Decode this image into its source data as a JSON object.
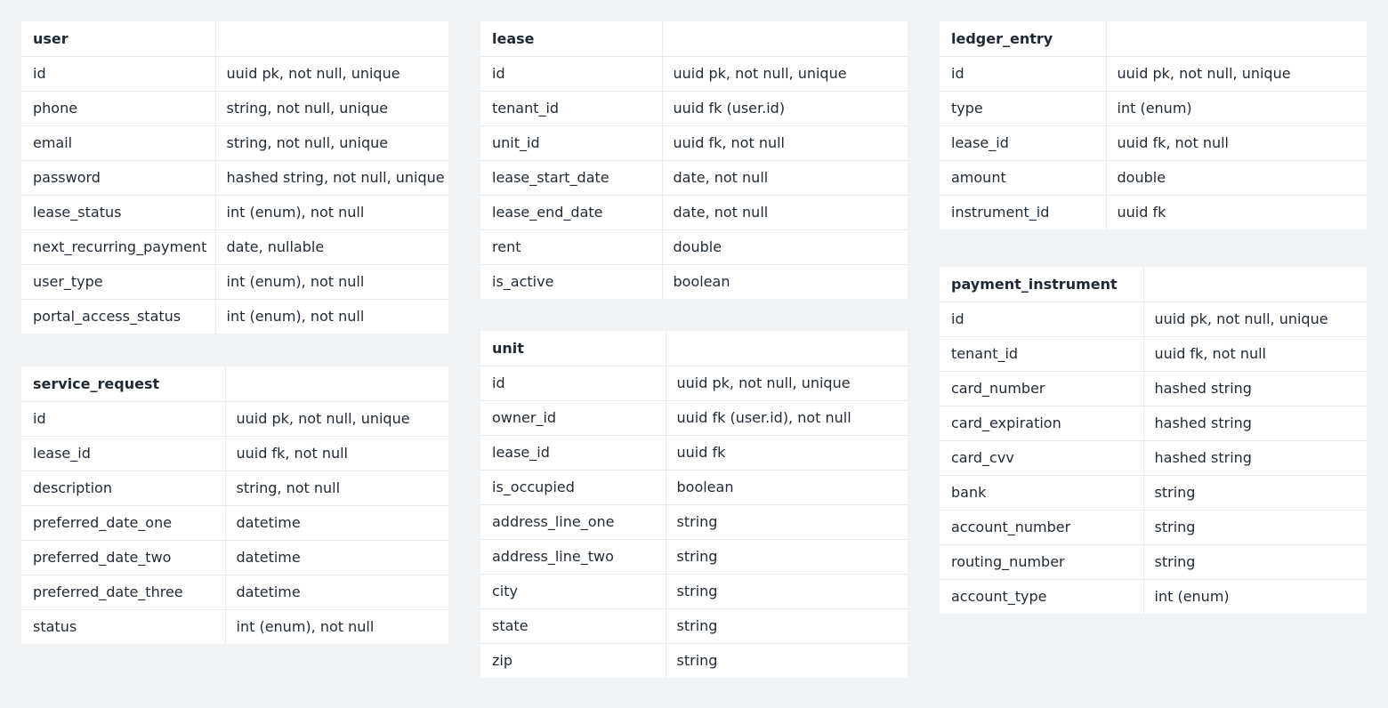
{
  "tables": {
    "user": {
      "title": "user",
      "rows": [
        {
          "field": "id",
          "spec": "uuid pk, not null, unique"
        },
        {
          "field": "phone",
          "spec": "string, not null, unique"
        },
        {
          "field": "email",
          "spec": "string, not null, unique"
        },
        {
          "field": "password",
          "spec": "hashed string, not null, unique"
        },
        {
          "field": "lease_status",
          "spec": "int (enum), not null"
        },
        {
          "field": "next_recurring_payment",
          "spec": "date, nullable"
        },
        {
          "field": "user_type",
          "spec": "int (enum), not null"
        },
        {
          "field": "portal_access_status",
          "spec": "int (enum),  not null"
        }
      ]
    },
    "service_request": {
      "title": "service_request",
      "rows": [
        {
          "field": "id",
          "spec": "uuid pk, not null, unique"
        },
        {
          "field": "lease_id",
          "spec": "uuid fk, not null"
        },
        {
          "field": "description",
          "spec": "string, not null"
        },
        {
          "field": "preferred_date_one",
          "spec": "datetime"
        },
        {
          "field": "preferred_date_two",
          "spec": "datetime"
        },
        {
          "field": "preferred_date_three",
          "spec": "datetime"
        },
        {
          "field": "status",
          "spec": "int (enum), not null"
        }
      ]
    },
    "lease": {
      "title": "lease",
      "rows": [
        {
          "field": "id",
          "spec": "uuid pk, not null, unique"
        },
        {
          "field": "tenant_id",
          "spec": "uuid fk (user.id)"
        },
        {
          "field": "unit_id",
          "spec": "uuid fk, not null"
        },
        {
          "field": "lease_start_date",
          "spec": "date, not null"
        },
        {
          "field": "lease_end_date",
          "spec": "date, not null"
        },
        {
          "field": "rent",
          "spec": "double"
        },
        {
          "field": "is_active",
          "spec": "boolean"
        }
      ]
    },
    "unit": {
      "title": "unit",
      "rows": [
        {
          "field": "id",
          "spec": "uuid pk, not null, unique"
        },
        {
          "field": "owner_id",
          "spec": "uuid fk (user.id), not null"
        },
        {
          "field": "lease_id",
          "spec": "uuid fk"
        },
        {
          "field": "is_occupied",
          "spec": "boolean"
        },
        {
          "field": "address_line_one",
          "spec": "string"
        },
        {
          "field": "address_line_two",
          "spec": "string"
        },
        {
          "field": "city",
          "spec": "string"
        },
        {
          "field": "state",
          "spec": "string"
        },
        {
          "field": "zip",
          "spec": "string"
        }
      ]
    },
    "ledger_entry": {
      "title": "ledger_entry",
      "rows": [
        {
          "field": "id",
          "spec": "uuid pk, not null, unique"
        },
        {
          "field": "type",
          "spec": "int (enum)"
        },
        {
          "field": "lease_id",
          "spec": "uuid fk, not null"
        },
        {
          "field": "amount",
          "spec": "double"
        },
        {
          "field": "instrument_id",
          "spec": "uuid fk"
        }
      ]
    },
    "payment_instrument": {
      "title": "payment_instrument",
      "rows": [
        {
          "field": "id",
          "spec": "uuid pk, not null, unique"
        },
        {
          "field": "tenant_id",
          "spec": "uuid fk, not null"
        },
        {
          "field": "card_number",
          "spec": "hashed string"
        },
        {
          "field": "card_expiration",
          "spec": "hashed string"
        },
        {
          "field": "card_cvv",
          "spec": "hashed string"
        },
        {
          "field": "bank",
          "spec": "string"
        },
        {
          "field": "account_number",
          "spec": "string"
        },
        {
          "field": "routing_number",
          "spec": "string"
        },
        {
          "field": "account_type",
          "spec": "int (enum)"
        }
      ]
    }
  }
}
